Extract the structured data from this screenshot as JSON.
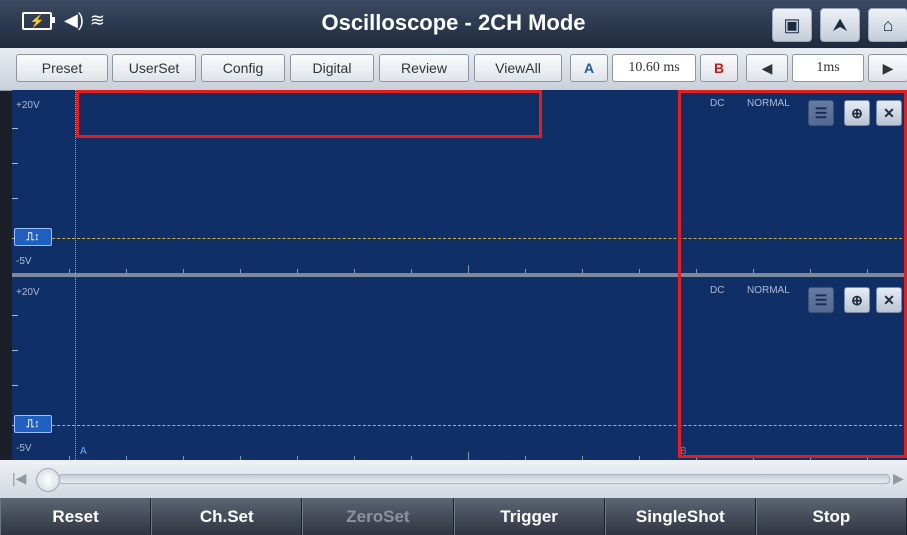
{
  "title": "Oscilloscope - 2CH Mode",
  "status": {
    "battery_icon": "battery-charging-icon",
    "volume_icon": "speaker-icon",
    "wifi_icon": "wifi-icon"
  },
  "title_buttons": [
    {
      "name": "screenshot-icon",
      "glyph": "▣"
    },
    {
      "name": "upload-icon",
      "glyph": "⮝"
    },
    {
      "name": "home-icon",
      "glyph": "⌂"
    }
  ],
  "toolbar": {
    "preset": "Preset",
    "userset": "UserSet",
    "config": "Config",
    "digital": "Digital",
    "review": "Review",
    "viewall": "ViewAll",
    "cursor_a": "A",
    "cursor_value": "10.60 ms",
    "cursor_b": "B",
    "timebase": "1ms"
  },
  "channels": [
    {
      "top_label": "+20V",
      "bottom_label": "-5V",
      "coupling": "DC",
      "mode": "NORMAL",
      "marker": "",
      "trigger_glyph": "⎍↕"
    },
    {
      "top_label": "+20V",
      "bottom_label": "-5V",
      "coupling": "DC",
      "mode": "NORMAL",
      "marker": "A",
      "trigger_glyph": "⎍↕"
    }
  ],
  "cursor_b_marker": "B",
  "bottom_buttons": {
    "reset": "Reset",
    "chset": "Ch.Set",
    "zeroset": "ZeroSet",
    "trigger": "Trigger",
    "singleshot": "SingleShot",
    "stop": "Stop"
  },
  "colors": {
    "screen_bg": "#0f2f66",
    "highlight": "#e31e1e",
    "trigger_line": "#c8b04a"
  }
}
